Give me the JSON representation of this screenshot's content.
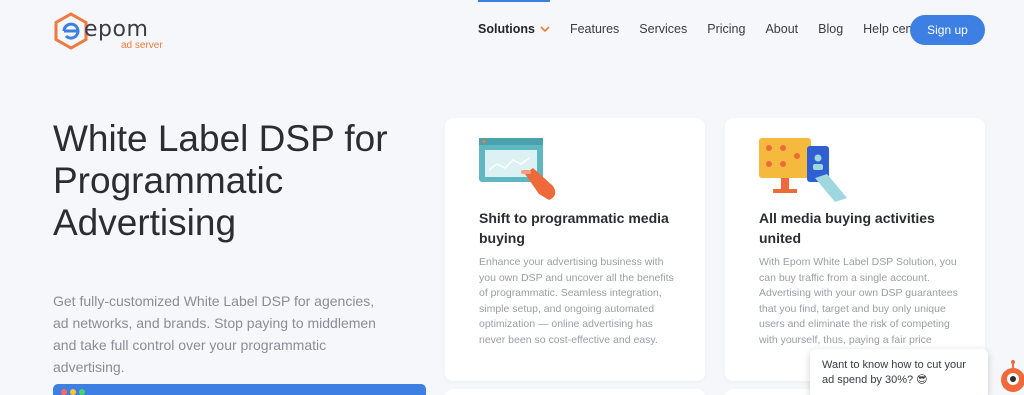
{
  "brand": {
    "name": "epom",
    "sub": "ad server"
  },
  "nav": {
    "items": [
      {
        "label": "Solutions",
        "active": true,
        "has_dropdown": true
      },
      {
        "label": "Features"
      },
      {
        "label": "Services"
      },
      {
        "label": "Pricing"
      },
      {
        "label": "About"
      },
      {
        "label": "Blog"
      },
      {
        "label": "Help center"
      }
    ],
    "signup_label": "Sign up"
  },
  "hero": {
    "title": "White Label DSP for Programmatic Advertising",
    "description": "Get fully-customized White Label DSP for agencies, ad networks, and brands. Stop paying to middlemen and take full control over your programmatic advertising."
  },
  "cards": [
    {
      "icon": "browser-hand-icon",
      "title": "Shift to programmatic media buying",
      "text": "Enhance your advertising business with you own DSP and uncover all the benefits of programmatic. Seamless integration, simple setup, and ongoing automated optimization — online advertising has never been so cost-effective and easy."
    },
    {
      "icon": "audience-monitor-icon",
      "title": "All media buying activities united",
      "text": "With Epom White Label DSP Solution, you can buy traffic from a single account. Advertising with your own DSP guarantees that you find, target and buy only unique users and eliminate the risk of competing with yourself, thus, paying a fair price"
    }
  ],
  "chat": {
    "message": "Want to know how to cut your ad spend by 30%? 😎"
  },
  "colors": {
    "accent": "#3d7fe2",
    "brand_orange": "#ef7a3e",
    "background": "#f6f7fb"
  }
}
